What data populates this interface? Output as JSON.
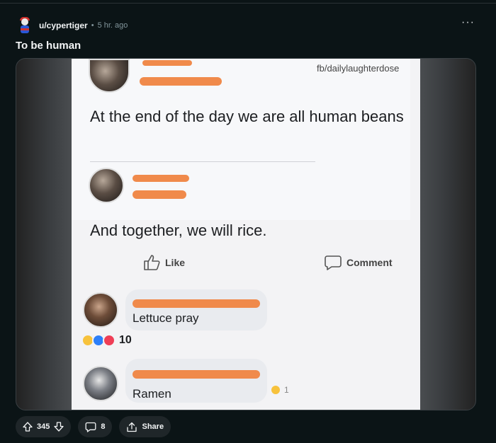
{
  "post": {
    "username": "u/cypertiger",
    "separator": "•",
    "time_ago": "5 hr. ago",
    "title": "To be human",
    "more_label": "···"
  },
  "media": {
    "source": "fb/dailylaughterdose",
    "post_text": "At the end of the day we are all human beans",
    "reply_text": "And together, we will rice.",
    "like_label": "Like",
    "comment_label": "Comment",
    "comment1": "Lettuce pray",
    "comment1_reactions": "10",
    "comment2": "Ramen",
    "comment2_reactions": "1"
  },
  "footer": {
    "votes": "345",
    "comments": "8",
    "share_label": "Share"
  },
  "colors": {
    "background": "#0b1416",
    "pill": "#1f2629",
    "redaction": "#f08a4b"
  }
}
